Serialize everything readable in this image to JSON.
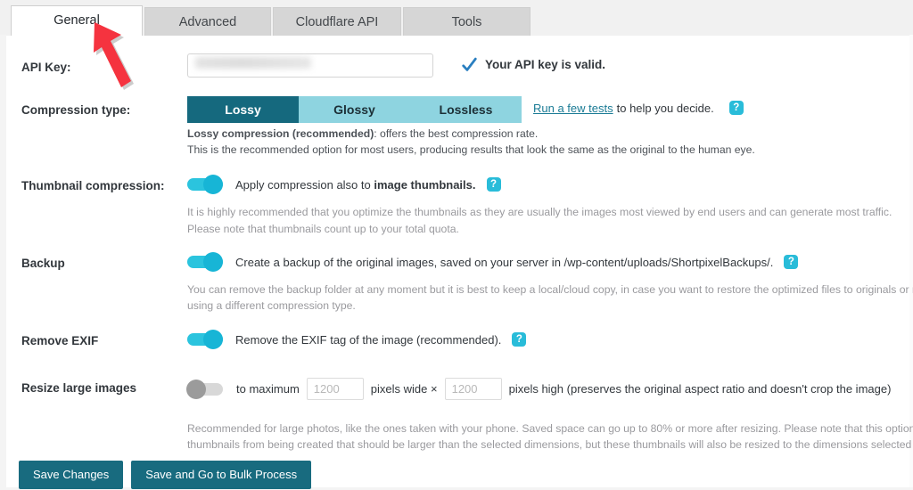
{
  "tabs": [
    {
      "label": "General",
      "active": true
    },
    {
      "label": "Advanced",
      "active": false
    },
    {
      "label": "Cloudflare API",
      "active": false
    },
    {
      "label": "Tools",
      "active": false
    }
  ],
  "colors": {
    "accent_dark_teal": "#15697e",
    "accent_light_teal": "#8ed4e0",
    "toggle_on": "#2bc4de",
    "toggle_knob_on": "#17b5d6",
    "toggle_off": "#d8d8d8",
    "help_icon": "#29bcd9",
    "link": "#1a7b95",
    "button": "#186b7f",
    "annotation_arrow": "#f5333f"
  },
  "annotation": {
    "arrow_name": "red-arrow-pointing-at-general-tab"
  },
  "api_key": {
    "label": "API Key:",
    "value": "",
    "placeholder": "",
    "masked": true,
    "status_text": "Your API key is valid.",
    "status_icon": "check-icon"
  },
  "compression": {
    "label": "Compression type:",
    "options": [
      "Lossy",
      "Glossy",
      "Lossless"
    ],
    "selected": "Lossy",
    "link_text": "Run a few tests",
    "link_tail": "to help you decide.",
    "help_icon": "?",
    "note_line1_bold": "Lossy compression (recommended)",
    "note_line1_rest": ": offers the best compression rate.",
    "note_line2": "This is the recommended option for most users, producing results that look the same as the original to the human eye."
  },
  "thumbnail": {
    "label": "Thumbnail compression:",
    "enabled": true,
    "text_lead": "Apply compression also to ",
    "text_bold": "image thumbnails.",
    "help_icon": "?",
    "note_line1": "It is highly recommended that you optimize the thumbnails as they are usually the images most viewed by end users and can generate most traffic.",
    "note_line2": "Please note that thumbnails count up to your total quota."
  },
  "backup": {
    "label": "Backup",
    "enabled": true,
    "text": "Create a backup of the original images, saved on your server in /wp-content/uploads/ShortpixelBackups/.",
    "help_icon": "?",
    "note_line1": "You can remove the backup folder at any moment but it is best to keep a local/cloud copy, in case you want to restore the optimized files to originals or re-optimize the images",
    "note_line2": "using a different compression type."
  },
  "exif": {
    "label": "Remove EXIF",
    "enabled": true,
    "text": "Remove the EXIF tag of the image (recommended).",
    "help_icon": "?"
  },
  "resize": {
    "label": "Resize large images",
    "enabled": false,
    "lead_text": "to maximum",
    "width_value": "",
    "width_placeholder": "1200",
    "mid_text": "pixels wide ×",
    "height_value": "",
    "height_placeholder": "1200",
    "tail_text": "pixels high (preserves the original aspect ratio and doesn't crop the image)",
    "note_line1": "Recommended for large photos, like the ones taken with your phone. Saved space can go up to 80% or more after resizing. Please note that this option does not prevent",
    "note_line2": "thumbnails from being created that should be larger than the selected dimensions, but these thumbnails will also be resized to the dimensions selected here."
  },
  "footer": {
    "save_label": "Save Changes",
    "bulk_label": "Save and Go to Bulk Process"
  }
}
